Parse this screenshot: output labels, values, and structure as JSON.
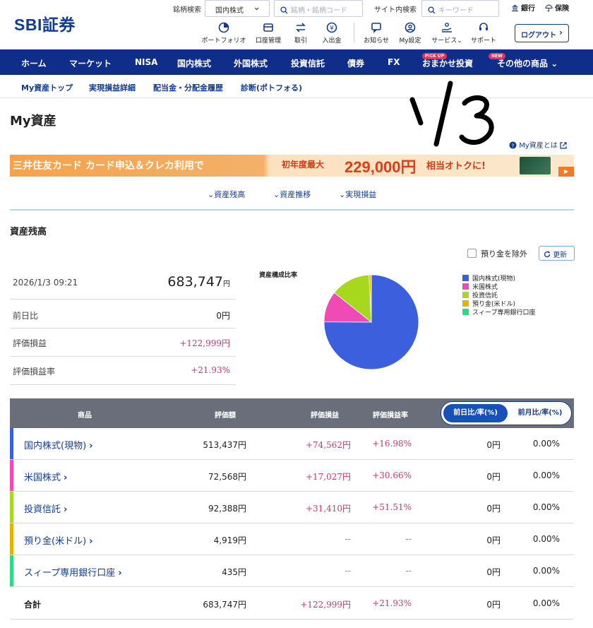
{
  "header": {
    "logo": "SBI証券",
    "brand_search_label": "銘柄検索",
    "brand_select": "国内株式",
    "brand_search_placeholder": "銘柄・銘柄コード",
    "site_search_label": "サイト内検索",
    "site_search_placeholder": "キーワード",
    "bank_link": "銀行",
    "insurance_link": "保険",
    "icon_buttons": [
      {
        "label": "ポートフォリオ",
        "icon": "portfolio-icon"
      },
      {
        "label": "口座管理",
        "icon": "account-icon"
      },
      {
        "label": "取引",
        "icon": "trade-icon"
      },
      {
        "label": "入出金",
        "icon": "deposit-icon"
      },
      {
        "label": "お知らせ",
        "icon": "notice-icon"
      },
      {
        "label": "My設定",
        "icon": "mysettings-icon"
      },
      {
        "label": "サービス",
        "icon": "service-icon"
      },
      {
        "label": "サポート",
        "icon": "support-icon"
      }
    ],
    "logout": "ログアウト"
  },
  "mainnav": {
    "items": [
      "ホーム",
      "マーケット",
      "NISA",
      "国内株式",
      "外国株式",
      "投資信託",
      "債券",
      "FX",
      "おまかせ投資",
      "その他の商品"
    ],
    "badge_pickup": "PICK UP",
    "badge_new": "NEW"
  },
  "subnav": [
    "My資産トップ",
    "実現損益詳細",
    "配当金・分配金履歴",
    "診断(ポトフォる)"
  ],
  "page": {
    "title": "My資産",
    "handwritten_note": "1/3",
    "help_link": "My資産とは"
  },
  "banner": {
    "text1": "三井住友カード カード申込＆クレカ利用で",
    "text2": "初年度最大",
    "amount": "229,000円",
    "text3": "相当オトクに!"
  },
  "anchors": [
    "資産残高",
    "資産推移",
    "実現損益"
  ],
  "section": {
    "title": "資産残高",
    "exclude_label": "預り金を除外",
    "refresh": "更新"
  },
  "summary": {
    "datetime": "2026/1/3 09:21",
    "total": "683,747",
    "total_unit": "円",
    "rows": [
      {
        "label": "前日比",
        "value": "0円"
      },
      {
        "label": "評価損益",
        "value": "+122,999円"
      },
      {
        "label": "評価損益率",
        "value": "+21.93%"
      }
    ]
  },
  "chart_data": {
    "type": "pie",
    "title": "資産構成比率",
    "categories": [
      "国内株式(現物)",
      "米国株式",
      "投資信託",
      "預り金(米ドル)",
      "スィープ専用銀行口座"
    ],
    "values": [
      513437,
      72568,
      92388,
      4919,
      435
    ],
    "colors": [
      "#3b5fdd",
      "#f04bb5",
      "#a8d81e",
      "#e0b400",
      "#2fd98a"
    ],
    "legend": "right"
  },
  "table": {
    "headers": [
      "商品",
      "評価額",
      "評価損益",
      "評価損益率"
    ],
    "toggle_on": "前日比/率(%)",
    "toggle_off": "前月比/率(%)",
    "rows": [
      {
        "name": "国内株式(現物)",
        "value": "513,437円",
        "gain": "+74,562円",
        "rate": "+16.98%",
        "day": "0円",
        "day_rate": "0.00%",
        "color": "#3b5fdd"
      },
      {
        "name": "米国株式",
        "value": "72,568円",
        "gain": "+17,027円",
        "rate": "+30.66%",
        "day": "0円",
        "day_rate": "0.00%",
        "color": "#f04bb5"
      },
      {
        "name": "投資信託",
        "value": "92,388円",
        "gain": "+31,410円",
        "rate": "+51.51%",
        "day": "0円",
        "day_rate": "0.00%",
        "color": "#a8d81e"
      },
      {
        "name": "預り金(米ドル)",
        "value": "4,919円",
        "gain": "--",
        "rate": "--",
        "day": "0円",
        "day_rate": "0.00%",
        "color": "#e0b400"
      },
      {
        "name": "スィープ専用銀行口座",
        "value": "435円",
        "gain": "--",
        "rate": "--",
        "day": "0円",
        "day_rate": "0.00%",
        "color": "#2fd98a"
      }
    ],
    "total": {
      "name": "合計",
      "value": "683,747円",
      "gain": "+122,999円",
      "rate": "+21.93%",
      "day": "0円",
      "day_rate": "0.00%"
    }
  }
}
